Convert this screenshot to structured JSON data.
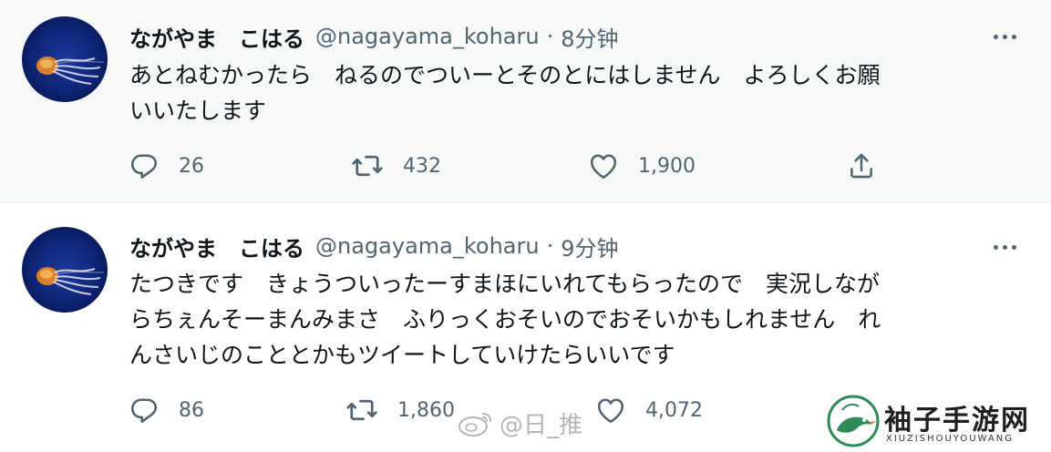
{
  "tweets": [
    {
      "display_name": "ながやま　こはる",
      "handle": "@nagayama_koharu",
      "separator": "·",
      "time": "8分钟",
      "text": "あとねむかったら　ねるのでついーとそのとにはしません　よろしくお願\nいいたします",
      "replies": "26",
      "retweets": "432",
      "likes": "1,900"
    },
    {
      "display_name": "ながやま　こはる",
      "handle": "@nagayama_koharu",
      "separator": "·",
      "time": "9分钟",
      "text": "たつきです　きょうついったーすまほにいれてもらったので　実況しなが\nらちぇんそーまんみまさ　ふりっくおそいのでおそいかもしれません　れ\nんさいじのこととかもツイートしていけたらいいです",
      "replies": "86",
      "retweets": "1,860",
      "likes": "4,072"
    }
  ],
  "icons": {
    "reply": "reply-icon",
    "retweet": "retweet-icon",
    "like": "heart-icon",
    "share": "share-icon",
    "more": "more-icon"
  },
  "watermark": {
    "weibo_text": "@日_推"
  },
  "site_logo": {
    "title": "袖子手游网",
    "subtitle": "XIUZISHOUYOUWANG"
  },
  "colors": {
    "text_primary": "#0f1419",
    "text_secondary": "#536471",
    "tweet_hover_bg": "#f7f9f9",
    "logo_green": "#2e8b57"
  }
}
